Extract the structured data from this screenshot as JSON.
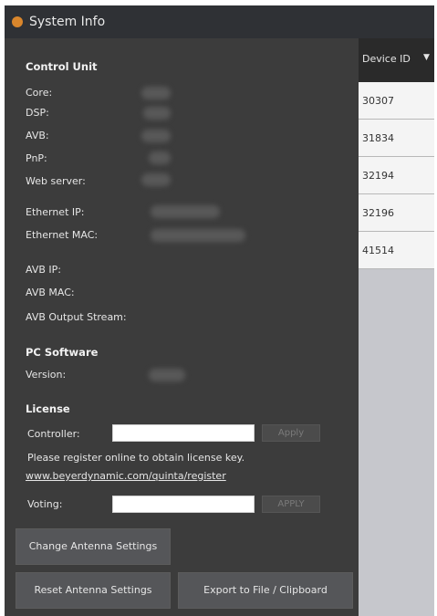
{
  "window": {
    "title": "System Info",
    "icon": "app-icon"
  },
  "control_unit": {
    "heading": "Control Unit",
    "core_label": "Core:",
    "dsp_label": "DSP:",
    "avb_label": "AVB:",
    "pnp_label": "PnP:",
    "web_server_label": "Web server:",
    "ethernet_ip_label": "Ethernet IP:",
    "ethernet_mac_label": "Ethernet MAC:",
    "avb_ip_label": "AVB IP:",
    "avb_mac_label": "AVB MAC:",
    "avb_output_stream_label": "AVB Output Stream:"
  },
  "pc_software": {
    "heading": "PC Software",
    "version_label": "Version:"
  },
  "license": {
    "heading": "License",
    "controller_label": "Controller:",
    "controller_value": "",
    "controller_apply": "Apply",
    "register_text": "Please register online to obtain license key.",
    "register_link": "www.beyerdynamic.com/quinta/register",
    "voting_label": "Voting:",
    "voting_value": "",
    "voting_apply": "APPLY"
  },
  "buttons": {
    "change_antenna": "Change Antenna Settings",
    "reset_antenna": "Reset Antenna Settings",
    "export": "Export to File / Clipboard"
  },
  "device_list": {
    "header": "Device ID",
    "header_icon": "dropdown-arrow-icon",
    "rows": [
      "30307",
      "31834",
      "32194",
      "32196",
      "41514"
    ]
  },
  "colors": {
    "panel_bg": "#3c3c3c",
    "titlebar_bg": "#2f3135",
    "list_header_bg": "#2a2a2a",
    "list_bg": "#c6c7cc",
    "row_bg": "#f4f4f4",
    "button_bg": "#555659",
    "app_icon": "#d9862c"
  }
}
